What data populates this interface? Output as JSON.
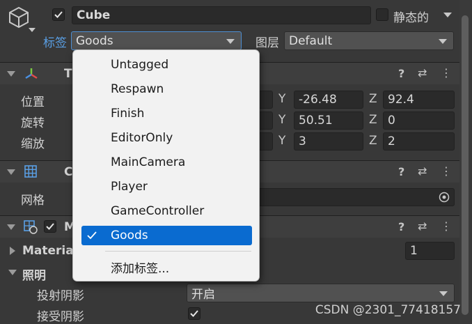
{
  "header": {
    "object_name": "Cube",
    "static_label": "静态的",
    "tag_label": "标签",
    "tag_value": "Goods",
    "layer_label": "图层",
    "layer_value": "Default"
  },
  "transform": {
    "title": "T",
    "position_label": "位置",
    "rotation_label": "旋转",
    "scale_label": "缩放",
    "y_axis": "Y",
    "z_axis": "Z",
    "position_y": "-26.48",
    "position_z": "92.4",
    "rotation_y": "50.51",
    "rotation_z": "0",
    "scale_y": "3",
    "scale_z": "2"
  },
  "mesh_filter": {
    "title": "C",
    "mesh_label": "网格"
  },
  "mesh_renderer": {
    "title": "M",
    "materials_label": "Materia",
    "materials_count": "1",
    "lighting_label": "照明",
    "cast_shadows_label": "投射阴影",
    "cast_shadows_value": "开启",
    "receive_shadows_label": "接受阴影"
  },
  "tag_menu": {
    "items": [
      {
        "label": "Untagged"
      },
      {
        "label": "Respawn"
      },
      {
        "label": "Finish"
      },
      {
        "label": "EditorOnly"
      },
      {
        "label": "MainCamera"
      },
      {
        "label": "Player"
      },
      {
        "label": "GameController"
      },
      {
        "label": "Goods"
      }
    ],
    "selected_index": 7,
    "add_tag_label": "添加标签..."
  },
  "icons": {
    "help": "?",
    "presets": "⇄",
    "more": "⋮"
  },
  "watermark": "CSDN @2301_77418157",
  "colors": {
    "background": "#383838",
    "menu_bg": "#f2f2f2",
    "selection": "#0a6bd0",
    "tag_accent": "#5aa0e6"
  }
}
